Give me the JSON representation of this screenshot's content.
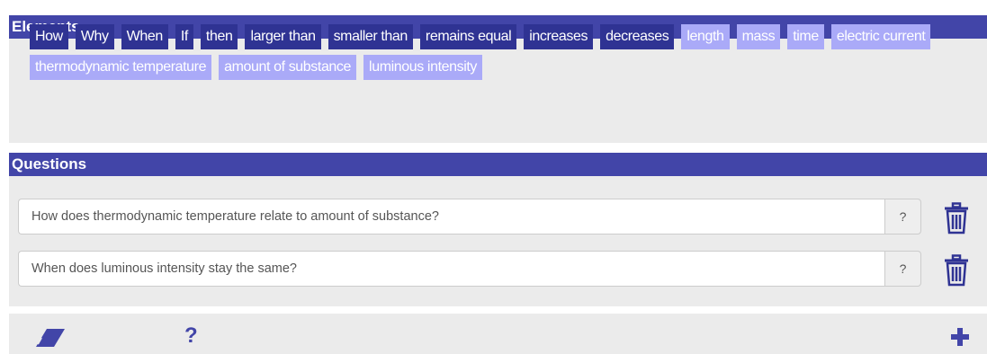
{
  "elements": {
    "title": "Elements",
    "chips": [
      {
        "label": "How",
        "style": "dark"
      },
      {
        "label": "Why",
        "style": "dark"
      },
      {
        "label": "When",
        "style": "dark"
      },
      {
        "label": "If",
        "style": "dark"
      },
      {
        "label": "then",
        "style": "dark"
      },
      {
        "label": "larger than",
        "style": "dark"
      },
      {
        "label": "smaller than",
        "style": "dark"
      },
      {
        "label": "remains equal",
        "style": "dark"
      },
      {
        "label": "increases",
        "style": "dark"
      },
      {
        "label": "decreases",
        "style": "dark"
      },
      {
        "label": "length",
        "style": "light"
      },
      {
        "label": "mass",
        "style": "light"
      },
      {
        "label": "time",
        "style": "light"
      },
      {
        "label": "electric current",
        "style": "light"
      },
      {
        "label": "thermodynamic temperature",
        "style": "light"
      },
      {
        "label": "amount of substance",
        "style": "light"
      },
      {
        "label": "luminous intensity",
        "style": "light"
      }
    ]
  },
  "questions": {
    "title": "Questions",
    "items": [
      {
        "value": "How does thermodynamic temperature relate to amount of substance?",
        "help": "?"
      },
      {
        "value": "When does luminous intensity stay the same?",
        "help": "?"
      }
    ]
  },
  "toolbar": {
    "eraser_icon": "eraser-icon",
    "help_label": "?",
    "add_icon": "plus-icon"
  },
  "colors": {
    "header": "#4245a8",
    "chip_dark": "#2f3393",
    "chip_light": "#aaaaf8",
    "panel": "#ebebeb"
  }
}
